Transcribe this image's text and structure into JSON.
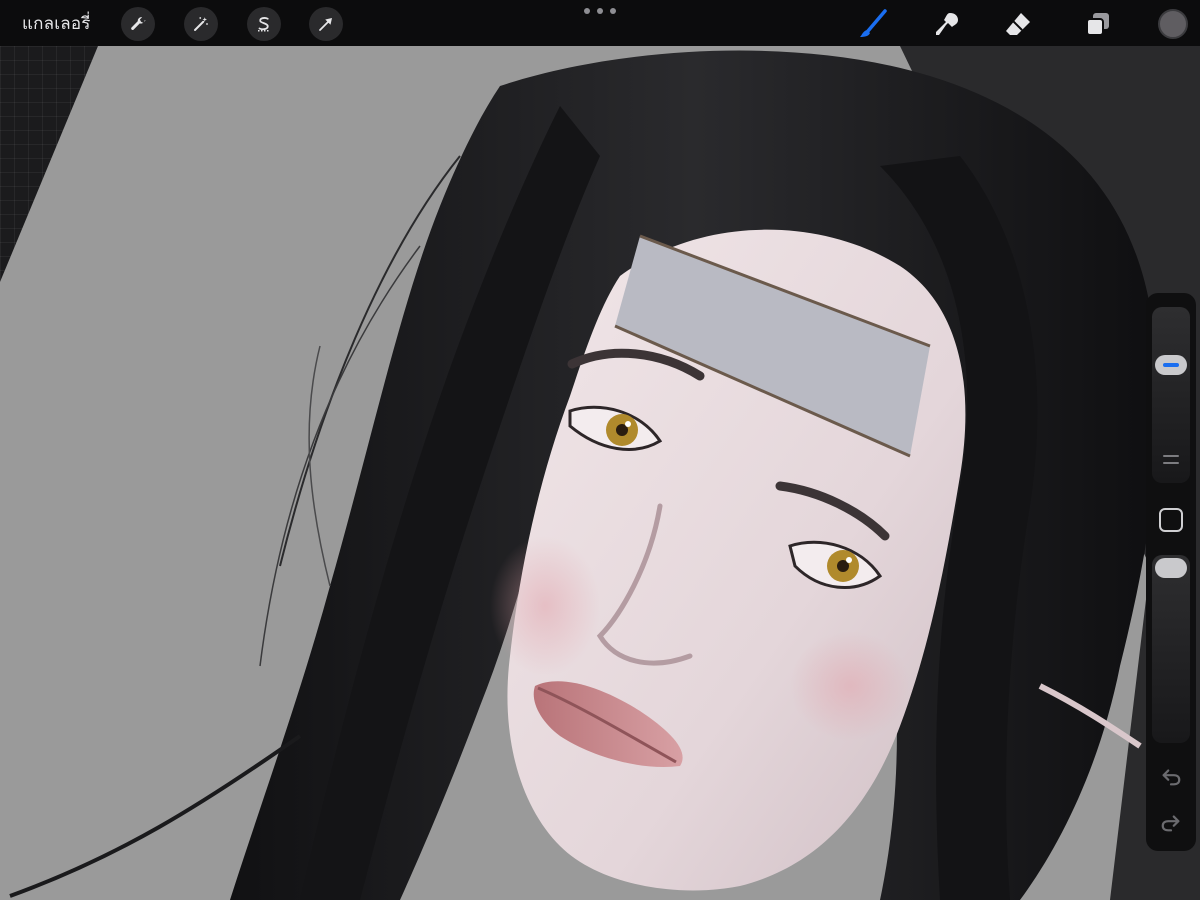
{
  "app": {
    "gallery_label": "แกลเลอรี่"
  },
  "toolbar": {
    "left_tools": [
      {
        "name": "wrench-icon",
        "label": "actions"
      },
      {
        "name": "magic-wand-icon",
        "label": "adjustments"
      },
      {
        "name": "selection-s-icon",
        "label": "selection"
      },
      {
        "name": "arrow-cursor-icon",
        "label": "transform"
      }
    ],
    "right_tools": [
      {
        "name": "brush-icon",
        "active": true
      },
      {
        "name": "smudge-icon",
        "active": false
      },
      {
        "name": "eraser-icon",
        "active": false
      },
      {
        "name": "layers-icon",
        "active": false
      }
    ],
    "current_color": "#5f5d61",
    "active_color": "#1a6ef0"
  },
  "sidebar": {
    "brush_size_level": 0.7,
    "opacity_level": 1.0
  },
  "colors": {
    "canvas_bg": "#9a9a9a",
    "hair": "#151517",
    "skin": "#e6d9dc",
    "headband": "#b9bac3",
    "eye": "#b08a2c",
    "lip": "#c98d91"
  }
}
